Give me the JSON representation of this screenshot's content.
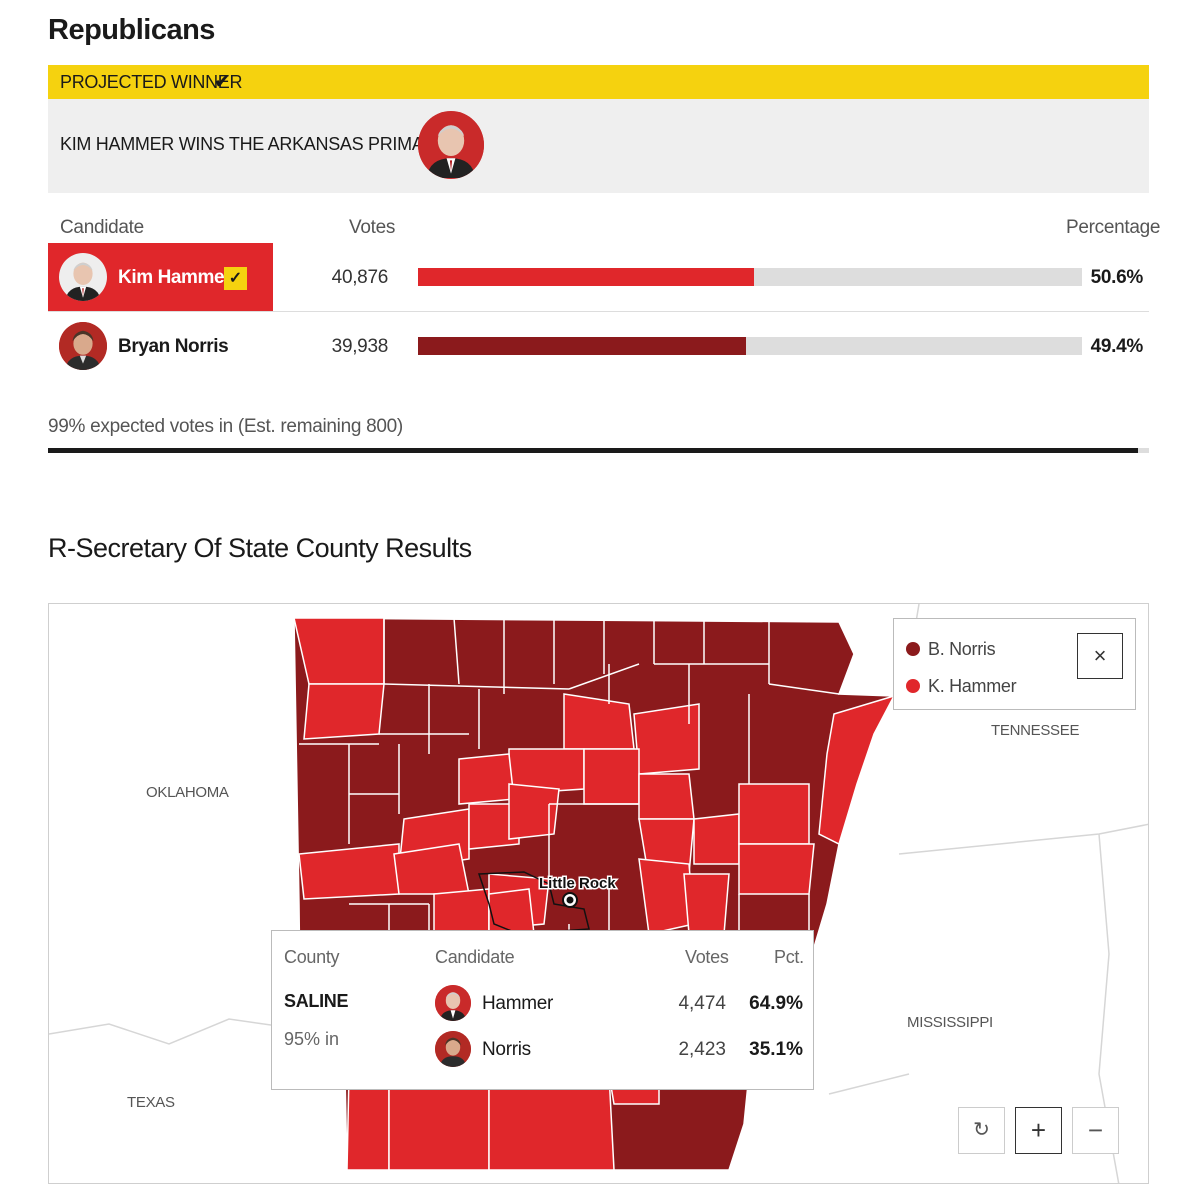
{
  "race": {
    "title": "Republicans",
    "winner_banner": "PROJECTED WINNER",
    "winner_headline": "KIM HAMMER WINS THE ARKANSAS PRIMARY"
  },
  "table": {
    "headers": {
      "candidate": "Candidate",
      "votes": "Votes",
      "percentage": "Percentage"
    },
    "candidates": [
      {
        "name": "Kim Hammer",
        "votes": "40,876",
        "pct": "50.6%",
        "share": 0.506,
        "winner": true,
        "color": "#e0272b"
      },
      {
        "name": "Bryan Norris",
        "votes": "39,938",
        "pct": "49.4%",
        "share": 0.494,
        "winner": false,
        "color": "#8b1a1c"
      }
    ]
  },
  "reporting": {
    "text": "99% expected votes in (Est. remaining 800)",
    "fraction": 0.99
  },
  "map": {
    "title": "R-Secretary Of State County Results",
    "states": {
      "oklahoma": "OKLAHOMA",
      "tennessee": "TENNESSEE",
      "texas": "TEXAS",
      "mississippi": "MISSISSIPPI"
    },
    "city": "Little Rock",
    "legend": [
      {
        "label": "B. Norris",
        "color": "#8b1a1c"
      },
      {
        "label": "K. Hammer",
        "color": "#e0272b"
      }
    ],
    "close_symbol": "×",
    "tooltip": {
      "headers": {
        "county": "County",
        "candidate": "Candidate",
        "votes": "Votes",
        "pct": "Pct."
      },
      "county": "SALINE",
      "in": "95% in",
      "rows": [
        {
          "name": "Hammer",
          "votes": "4,474",
          "pct": "64.9%"
        },
        {
          "name": "Norris",
          "votes": "2,423",
          "pct": "35.1%"
        }
      ]
    },
    "controls": {
      "reset": "↻",
      "zoom_in": "+",
      "zoom_out": "−"
    }
  }
}
